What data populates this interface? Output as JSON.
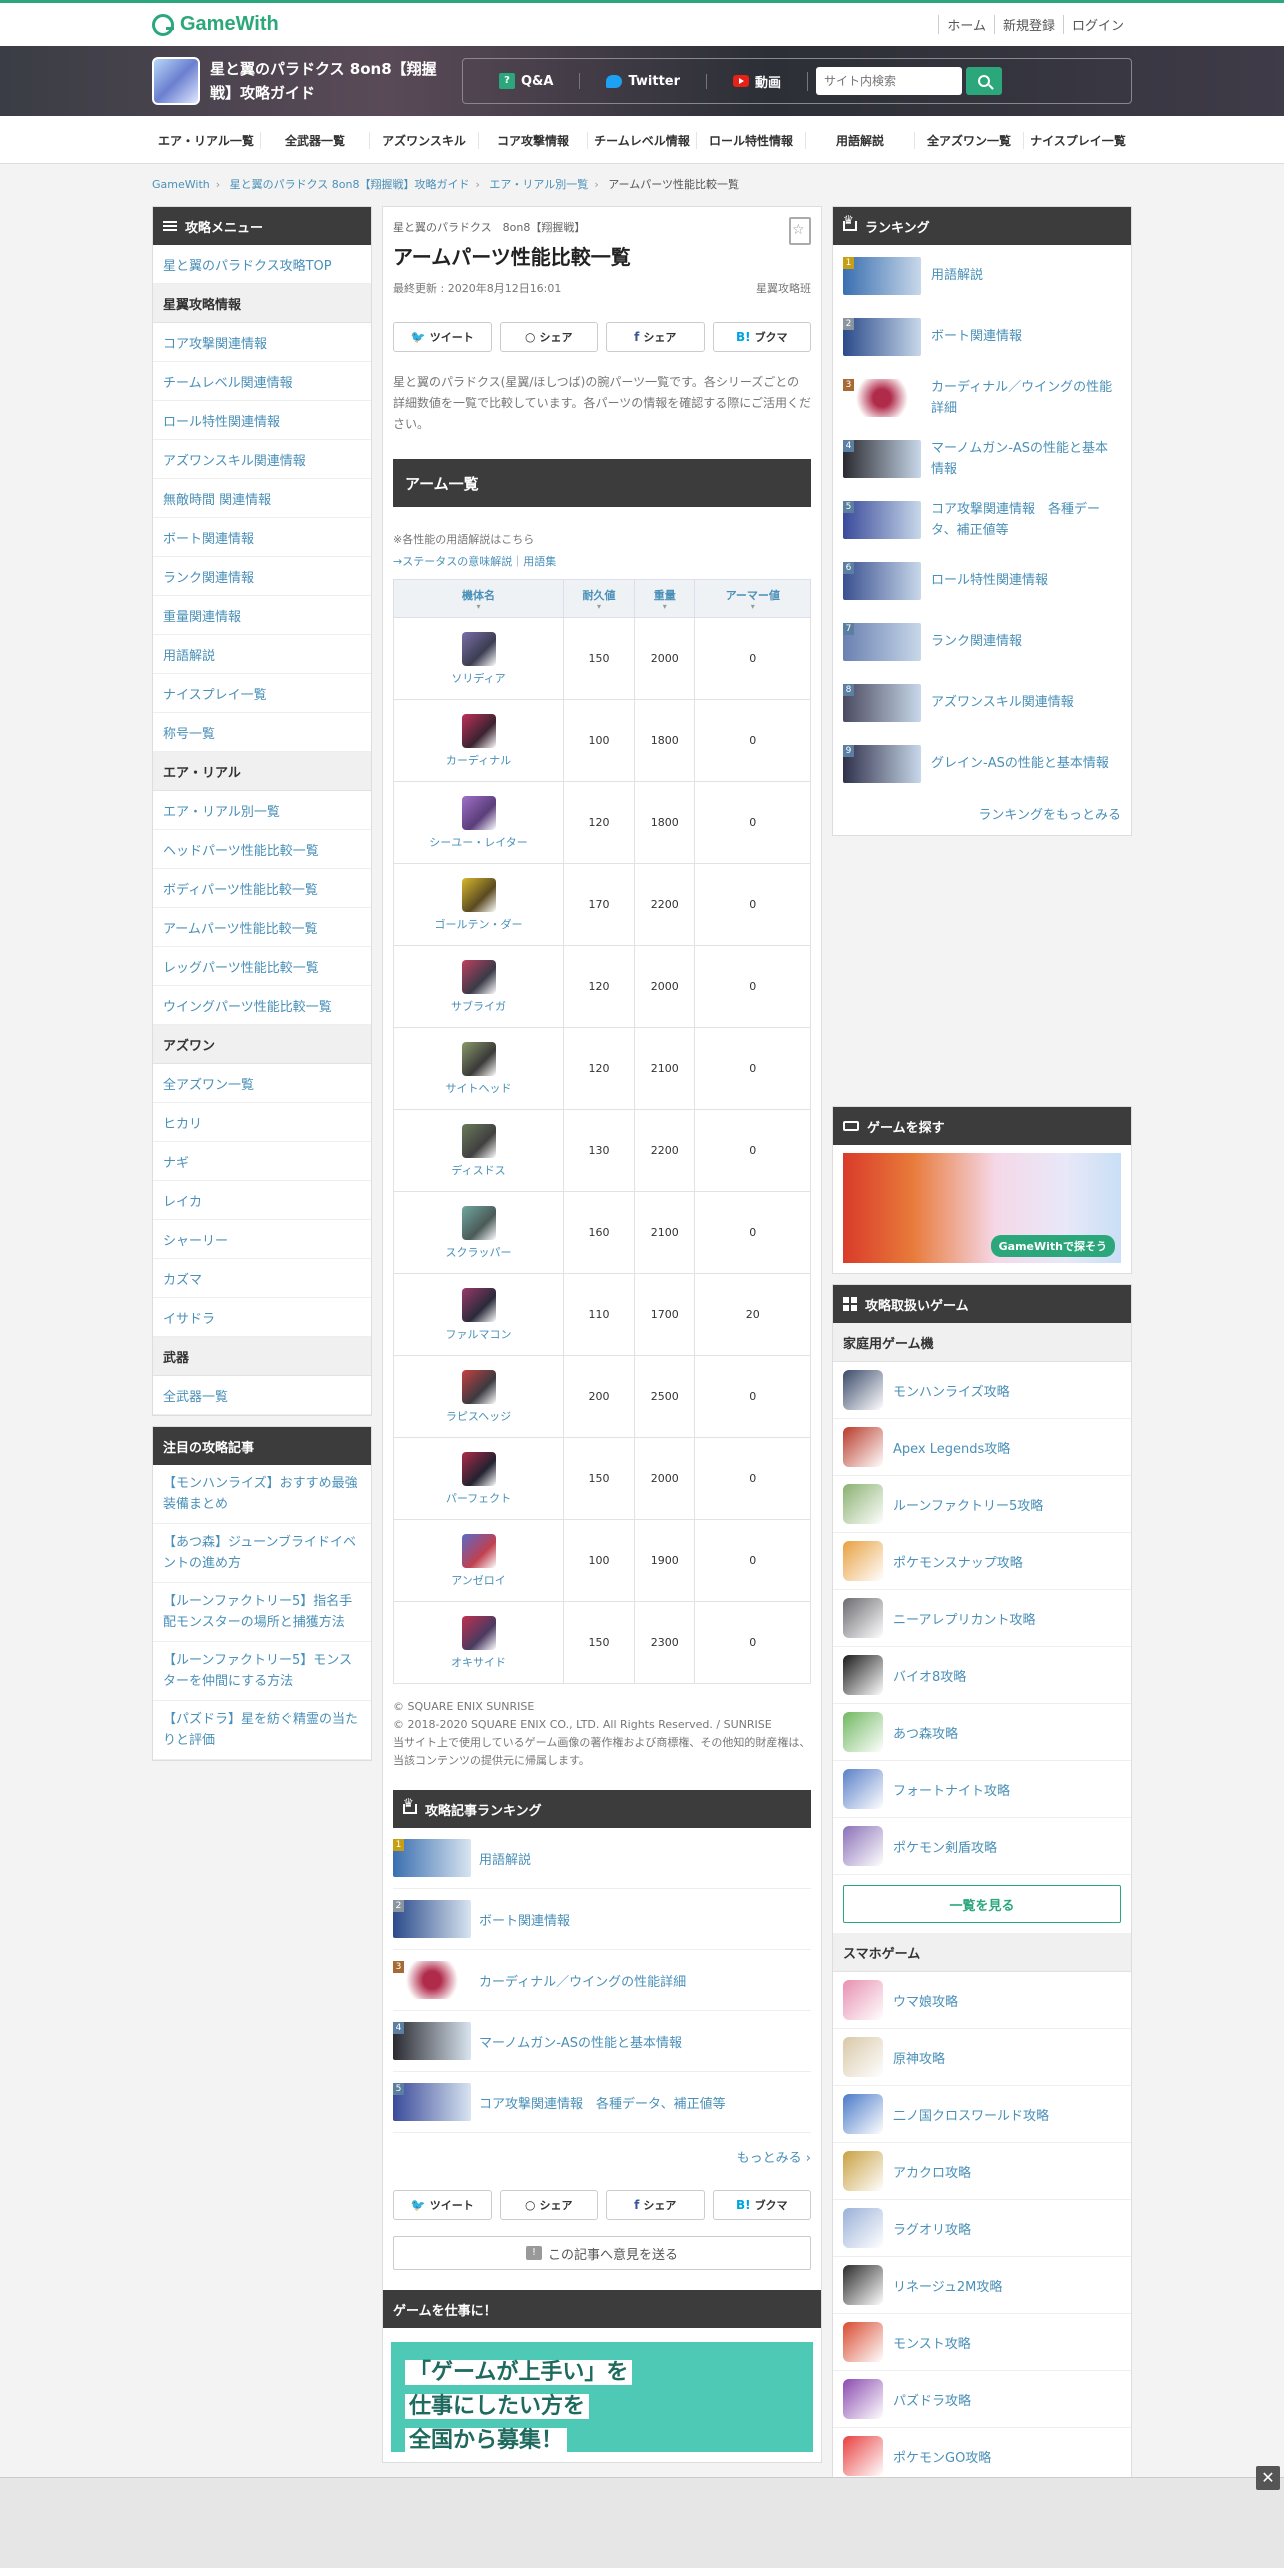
{
  "header": {
    "logo": "GameWith",
    "links": [
      "ホーム",
      "新規登録",
      "ログイン"
    ]
  },
  "gamebar": {
    "title": "星と翼のパラドクス 8on8【翔握戦】攻略ガイド",
    "nav": [
      "Q&A",
      "Twitter",
      "動画"
    ],
    "search_placeholder": "サイト内検索"
  },
  "catnav": [
    "エア・リアル一覧",
    "全武器一覧",
    "アズワンスキル",
    "コア攻撃情報",
    "チームレベル情報",
    "ロール特性情報",
    "用語解説",
    "全アズワン一覧",
    "ナイスプレイ一覧"
  ],
  "breadcrumb": [
    "GameWith",
    "星と翼のパラドクス 8on8【翔握戦】攻略ガイド",
    "エア・リアル別一覧",
    "アームパーツ性能比較一覧"
  ],
  "left_menu": {
    "title": "攻略メニュー",
    "top": "星と翼のパラドクス攻略TOP",
    "sections": [
      {
        "name": "星翼攻略情報",
        "items": [
          "コア攻撃関連情報",
          "チームレベル関連情報",
          "ロール特性関連情報",
          "アズワンスキル関連情報",
          "無敵時間 関連情報",
          "ボート関連情報",
          "ランク関連情報",
          "重量関連情報",
          "用語解説",
          "ナイスプレイ一覧",
          "称号一覧"
        ]
      },
      {
        "name": "エア・リアル",
        "items": [
          "エア・リアル別一覧",
          "ヘッドパーツ性能比較一覧",
          "ボディパーツ性能比較一覧",
          "アームパーツ性能比較一覧",
          "レッグパーツ性能比較一覧",
          "ウイングパーツ性能比較一覧"
        ]
      },
      {
        "name": "アズワン",
        "items": [
          "全アズワン一覧",
          "ヒカリ",
          "ナギ",
          "レイカ",
          "シャーリー",
          "カズマ",
          "イサドラ"
        ]
      },
      {
        "name": "武器",
        "items": [
          "全武器一覧"
        ]
      }
    ]
  },
  "featured": {
    "title": "注目の攻略記事",
    "items": [
      "【モンハンライズ】おすすめ最強装備まとめ",
      "【あつ森】ジューンブライドイベントの進め方",
      "【ルーンファクトリー5】指名手配モンスターの場所と捕獲方法",
      "【ルーンファクトリー5】モンスターを仲間にする方法",
      "【パズドラ】星を紡ぐ精霊の当たりと評価"
    ]
  },
  "article": {
    "subtitle": "星と翼のパラドクス　8on8【翔握戦】",
    "title": "アームパーツ性能比較一覧",
    "updated": "最終更新 : 2020年8月12日16:01",
    "author": "星翼攻略班",
    "share": [
      "ツイート",
      "シェア",
      "シェア",
      "ブクマ"
    ],
    "intro": "星と翼のパラドクス(星翼/ほしつば)の腕パーツ一覧です。各シリーズごとの詳細数値を一覧で比較しています。各パーツの情報を確認する際にご活用ください。",
    "section_title": "アーム一覧",
    "note1": "※各性能の用語解説はこちら",
    "note2": "→ステータスの意味解説｜用語集",
    "table": {
      "headers": [
        "機体名",
        "耐久値",
        "重量",
        "アーマー値"
      ],
      "rows": [
        {
          "name": "ソリディア",
          "hp": "150",
          "weight": "2000",
          "armor": "0",
          "c1": "#7a6fa8",
          "c2": "#3b3d52"
        },
        {
          "name": "カーディナル",
          "hp": "100",
          "weight": "1800",
          "armor": "0",
          "c1": "#c0305a",
          "c2": "#3a2330"
        },
        {
          "name": "シーユー・レイター",
          "hp": "120",
          "weight": "1800",
          "armor": "0",
          "c1": "#a070c8",
          "c2": "#5a3d7a"
        },
        {
          "name": "ゴールテン・ダー",
          "hp": "170",
          "weight": "2200",
          "armor": "0",
          "c1": "#d8b830",
          "c2": "#5a4a20"
        },
        {
          "name": "サブライガ",
          "hp": "120",
          "weight": "2000",
          "armor": "0",
          "c1": "#c04060",
          "c2": "#3a3a48"
        },
        {
          "name": "サイトヘッド",
          "hp": "120",
          "weight": "2100",
          "armor": "0",
          "c1": "#8a9a6a",
          "c2": "#3a3a38"
        },
        {
          "name": "ディスドス",
          "hp": "130",
          "weight": "2200",
          "armor": "0",
          "c1": "#6a7a5a",
          "c2": "#404040"
        },
        {
          "name": "スクラッパー",
          "hp": "160",
          "weight": "2100",
          "armor": "0",
          "c1": "#70a8a0",
          "c2": "#4a5a58"
        },
        {
          "name": "ファルマコン",
          "hp": "110",
          "weight": "1700",
          "armor": "20",
          "c1": "#9a3a6a",
          "c2": "#2a2a3a"
        },
        {
          "name": "ラピスヘッジ",
          "hp": "200",
          "weight": "2500",
          "armor": "0",
          "c1": "#c84040",
          "c2": "#3a3a40"
        },
        {
          "name": "パーフェクト",
          "hp": "150",
          "weight": "2000",
          "armor": "0",
          "c1": "#b02a4a",
          "c2": "#222230"
        },
        {
          "name": "アンゼロイ",
          "hp": "100",
          "weight": "1900",
          "armor": "0",
          "c1": "#5a6ac8",
          "c2": "#c04050"
        },
        {
          "name": "オキサイド",
          "hp": "150",
          "weight": "2300",
          "armor": "0",
          "c1": "#c03050",
          "c2": "#4a3a60"
        }
      ]
    },
    "copyright1": "© SQUARE ENIX SUNRISE",
    "copyright2": "© 2018-2020 SQUARE ENIX CO., LTD. All Rights Reserved. / SUNRISE",
    "copyright3": "当サイト上で使用しているゲーム画像の著作権および商標権、その他知的財産権は、当該コンテンツの提供元に帰属します。",
    "ranking_title": "攻略記事ランキング",
    "ranking": [
      "用語解説",
      "ボート関連情報",
      "カーディナル／ウイングの性能詳細",
      "マーノムガン-ASの性能と基本情報",
      "コア攻撃関連情報　各種データ、補正値等"
    ],
    "more": "もっとみる",
    "feedback": "この記事へ意見を送る",
    "jobs_title": "ゲームを仕事に！",
    "jobs_banner_l1": "「ゲームが上手い」を",
    "jobs_banner_l2": "仕事にしたい方を",
    "jobs_banner_l3": "全国から募集！"
  },
  "right": {
    "ranking_title": "ランキング",
    "ranking": [
      "用語解説",
      "ボート関連情報",
      "カーディナル／ウイングの性能詳細",
      "マーノムガン-ASの性能と基本情報",
      "コア攻撃関連情報　各種データ、補正値等",
      "ロール特性関連情報",
      "ランク関連情報",
      "アズワンスキル関連情報",
      "グレイン-ASの性能と基本情報"
    ],
    "ranking_more": "ランキングをもっとみる",
    "find_title": "ゲームを探す",
    "promo_label": "GameWithで探そう",
    "games_title": "攻略取扱いゲーム",
    "console_title": "家庭用ゲーム機",
    "console_games": [
      {
        "name": "モンハンライズ攻略",
        "color": "#3a4a6a"
      },
      {
        "name": "Apex Legends攻略",
        "color": "#b83a2a"
      },
      {
        "name": "ルーンファクトリー5攻略",
        "color": "#8ab070"
      },
      {
        "name": "ポケモンスナップ攻略",
        "color": "#e8a040"
      },
      {
        "name": "ニーアレプリカント攻略",
        "color": "#6a6a70"
      },
      {
        "name": "バイオ8攻略",
        "color": "#1a1a1a"
      },
      {
        "name": "あつ森攻略",
        "color": "#70b860"
      },
      {
        "name": "フォートナイト攻略",
        "color": "#5a80c8"
      },
      {
        "name": "ポケモン剣盾攻略",
        "color": "#8a70b8"
      }
    ],
    "see_all": "一覧を見る",
    "mobile_title": "スマホゲーム",
    "mobile_games": [
      {
        "name": "ウマ娘攻略",
        "color": "#e890b0"
      },
      {
        "name": "原神攻略",
        "color": "#d8c8a8"
      },
      {
        "name": "二ノ国クロスワールド攻略",
        "color": "#4a7ac8"
      },
      {
        "name": "アカクロ攻略",
        "color": "#c8a040"
      },
      {
        "name": "ラグオリ攻略",
        "color": "#9ab0d8"
      },
      {
        "name": "リネージュ2M攻略",
        "color": "#2a2a2a"
      },
      {
        "name": "モンスト攻略",
        "color": "#d84a30"
      },
      {
        "name": "パズドラ攻略",
        "color": "#8a4ab0"
      },
      {
        "name": "ポケモンGO攻略",
        "color": "#e84040"
      }
    ]
  },
  "adbar": {
    "close": "✕"
  }
}
